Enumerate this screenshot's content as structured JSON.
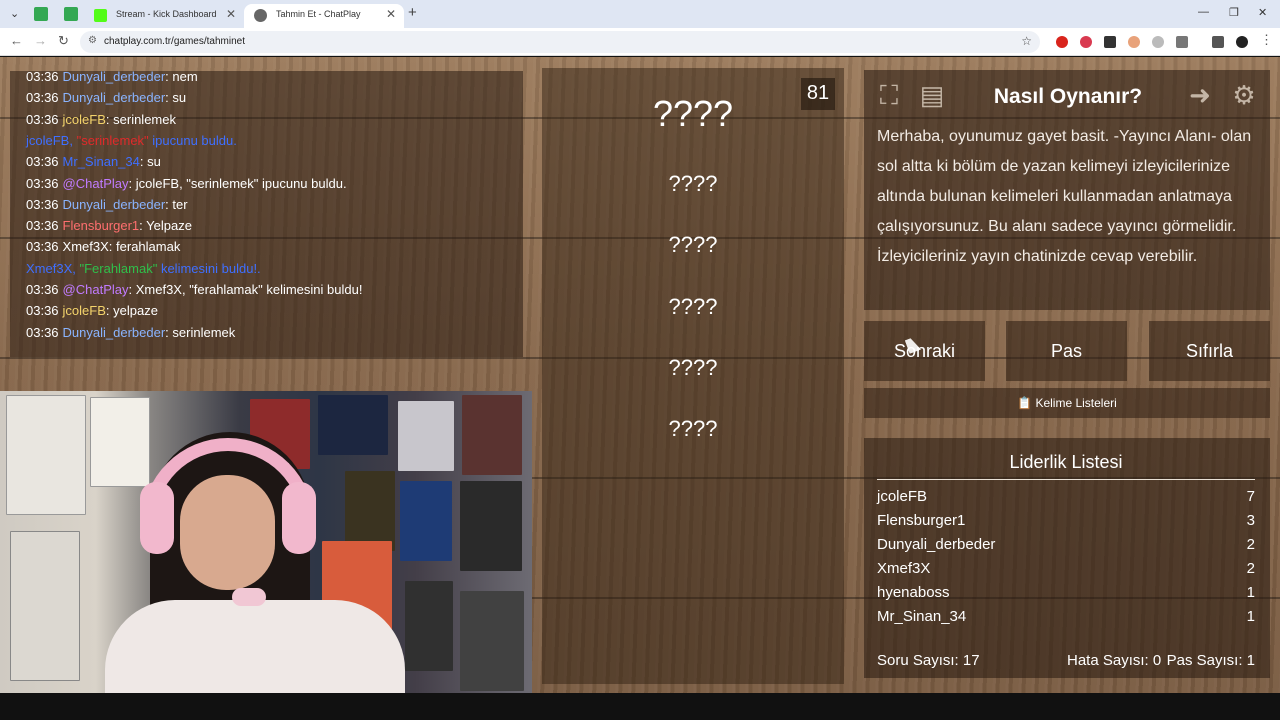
{
  "browser": {
    "tabs": [
      {
        "title": "Stream - Kick Dashboard"
      },
      {
        "title": "Tahmin Et - ChatPlay"
      }
    ],
    "url": "chatplay.com.tr/games/tahminet"
  },
  "chat": {
    "messages": [
      {
        "time": "03:36",
        "user": "Dunyali_derbeder",
        "user_color": "#8ab4ff",
        "text": ": nem"
      },
      {
        "time": "03:36",
        "user": "Dunyali_derbeder",
        "user_color": "#8ab4ff",
        "text": ": su"
      },
      {
        "time": "03:36",
        "user": "jcoleFB",
        "user_color": "#f3d36b",
        "text": ": serinlemek"
      },
      {
        "system": true,
        "parts": [
          "jcoleFB, ",
          "\"serinlemek\"",
          " ipucunu buldu."
        ],
        "colors": [
          "#3f6fff",
          "#e02a2a",
          "#3f6fff"
        ]
      },
      {
        "time": "03:36",
        "user": "Mr_Sinan_34",
        "user_color": "#3f6fff",
        "text": ": su"
      },
      {
        "time": "03:36",
        "user": "@ChatPlay",
        "user_color": "#c07bff",
        "text": ": jcoleFB, \"serinlemek\" ipucunu buldu."
      },
      {
        "time": "03:36",
        "user": "Dunyali_derbeder",
        "user_color": "#8ab4ff",
        "text": ": ter"
      },
      {
        "time": "03:36",
        "user": "Flensburger1",
        "user_color": "#ff6f6f",
        "text": ": Yelpaze"
      },
      {
        "time": "03:36",
        "user": "Xmef3X",
        "user_color": "#ffffff",
        "text": ": ferahlamak"
      },
      {
        "system": true,
        "parts": [
          "Xmef3X, ",
          "\"Ferahlamak\"",
          " kelimesini buldu!."
        ],
        "colors": [
          "#3f6fff",
          "#2fbf4a",
          "#3f6fff"
        ]
      },
      {
        "time": "03:36",
        "user": "@ChatPlay",
        "user_color": "#c07bff",
        "text": ": Xmef3X, \"ferahlamak\" kelimesini buldu!"
      },
      {
        "time": "03:36",
        "user": "jcoleFB",
        "user_color": "#f3d36b",
        "text": ": yelpaze"
      },
      {
        "time": "03:36",
        "user": "Dunyali_derbeder",
        "user_color": "#8ab4ff",
        "text": ": serinlemek"
      }
    ]
  },
  "game": {
    "counter": "81",
    "main_word": "????",
    "hint_slots": [
      "????",
      "????",
      "????",
      "????",
      "????"
    ]
  },
  "howto": {
    "title": "Nasıl Oynanır?",
    "text": "Merhaba, oyunumuz gayet basit. -Yayıncı Alanı- olan sol altta ki bölüm de yazan kelimeyi izleyicilerinize altında bulunan kelimeleri kullanmadan anlatmaya çalışıyorsunuz. Bu alanı sadece yayıncı görmelidir. İzleyicileriniz yayın chatinizde cevap verebilir."
  },
  "controls": {
    "next": "Sonraki",
    "pass": "Pas",
    "reset": "Sıfırla",
    "word_lists": "📋 Kelime Listeleri"
  },
  "leaderboard": {
    "title": "Liderlik Listesi",
    "rows": [
      {
        "name": "jcoleFB",
        "score": "7"
      },
      {
        "name": "Flensburger1",
        "score": "3"
      },
      {
        "name": "Dunyali_derbeder",
        "score": "2"
      },
      {
        "name": "Xmef3X",
        "score": "2"
      },
      {
        "name": "hyenaboss",
        "score": "1"
      },
      {
        "name": "Mr_Sinan_34",
        "score": "1"
      }
    ]
  },
  "stats": {
    "questions": "Soru Sayısı: 17",
    "errors": "Hata Sayısı: 0",
    "passes": "Pas Sayısı: 1"
  },
  "icons": [
    "fullscreen-icon",
    "notes-icon",
    "logout-icon",
    "gear-icon"
  ]
}
